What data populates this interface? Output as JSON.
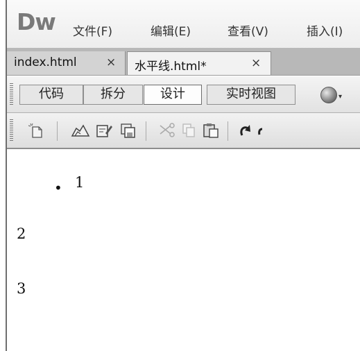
{
  "app": {
    "logo": "Dw"
  },
  "menu": {
    "items": [
      "文件(F)",
      "编辑(E)",
      "查看(V)",
      "插入(I)"
    ]
  },
  "tabs": [
    {
      "label": "index.html",
      "close": "×"
    },
    {
      "label": "水平线.html*",
      "close": "×"
    }
  ],
  "view_toolbar": {
    "buttons": [
      "代码",
      "拆分",
      "设计",
      "实时视图"
    ],
    "active": "设计"
  },
  "standard_toolbar": {
    "icons": [
      "new-document-icon",
      "open-icon",
      "edit-icon",
      "save-icon",
      "cut-icon",
      "copy-icon",
      "paste-icon",
      "undo-icon"
    ]
  },
  "document": {
    "list_item": "1",
    "paragraphs": [
      "2",
      "3"
    ]
  }
}
